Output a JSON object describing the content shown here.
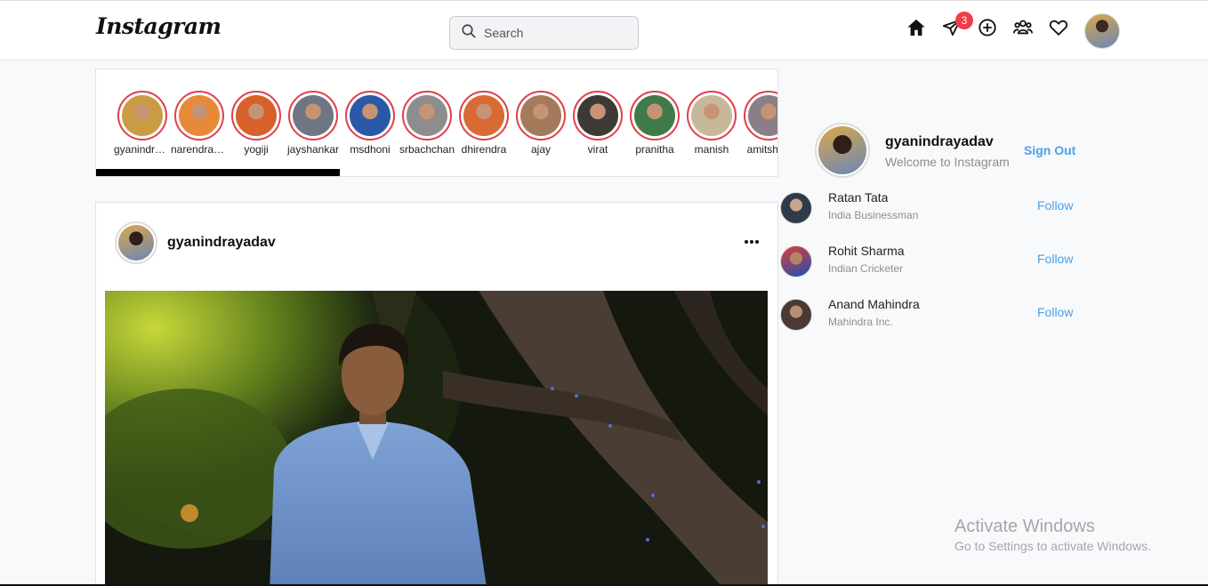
{
  "nav": {
    "logo": "Instagram",
    "search_placeholder": "Search",
    "messages_badge": "3",
    "icons": [
      "home-icon",
      "send-icon",
      "add-post-icon",
      "people-icon",
      "heart-icon"
    ]
  },
  "stories": [
    {
      "name": "gyanindrayadav",
      "color": "#c99b44"
    },
    {
      "name": "narendramodi",
      "color": "#e8893a"
    },
    {
      "name": "yogiji",
      "color": "#d8612b"
    },
    {
      "name": "jayshankar",
      "color": "#6e7583"
    },
    {
      "name": "msdhoni",
      "color": "#2b58a7"
    },
    {
      "name": "srbachchan",
      "color": "#8d8d8d"
    },
    {
      "name": "dhirendra",
      "color": "#d86b33"
    },
    {
      "name": "ajay",
      "color": "#a37a5c"
    },
    {
      "name": "virat",
      "color": "#3d3a36"
    },
    {
      "name": "pranitha",
      "color": "#3f7a4a"
    },
    {
      "name": "manish",
      "color": "#c8b89a"
    },
    {
      "name": "amitshah",
      "color": "#8a7f86"
    }
  ],
  "post": {
    "username": "gyanindrayadav",
    "more_label": "•••"
  },
  "profile": {
    "username": "gyanindrayadav",
    "welcome": "Welcome to Instagram",
    "sign_out": "Sign Out"
  },
  "suggestions": [
    {
      "name": "Ratan Tata",
      "desc": "India Businessman",
      "action": "Follow",
      "color": "#2f3a4b"
    },
    {
      "name": "Rohit Sharma",
      "desc": "Indian Cricketer",
      "action": "Follow",
      "color": "#1f4fb3"
    },
    {
      "name": "Anand Mahindra",
      "desc": "Mahindra Inc.",
      "action": "Follow",
      "color": "#4a3a33"
    }
  ],
  "watermark": {
    "line1": "Activate Windows",
    "line2": "Go to Settings to activate Windows."
  },
  "colors": {
    "accent": "#4da0e6",
    "story_ring": "#e0404a",
    "badge": "#ef3e4a"
  }
}
